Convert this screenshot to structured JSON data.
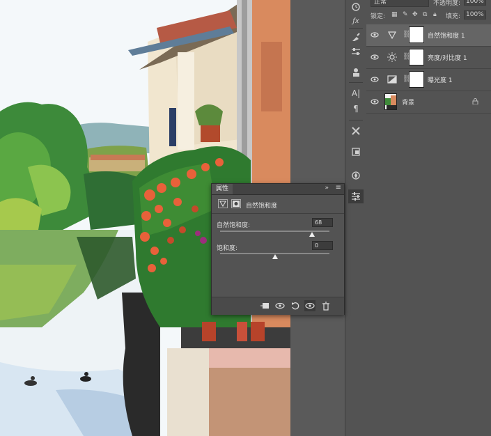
{
  "layers_panel": {
    "blend_mode": "正常",
    "opacity_label": "不透明度:",
    "opacity_value": "100%",
    "lock_label": "锁定:",
    "fill_label": "填充:",
    "fill_value": "100%",
    "layers": [
      {
        "name": "自然饱和度 1",
        "type": "vibrance",
        "selected": true
      },
      {
        "name": "亮度/对比度 1",
        "type": "brightness-contrast",
        "selected": false
      },
      {
        "name": "曝光度 1",
        "type": "exposure",
        "selected": false
      },
      {
        "name": "背景",
        "type": "background",
        "selected": false,
        "locked": true
      }
    ]
  },
  "properties_panel": {
    "tab_label": "属性",
    "adjustment_title": "自然饱和度",
    "vibrance": {
      "label": "自然饱和度:",
      "value": "68",
      "fraction": 0.84
    },
    "saturation": {
      "label": "饱和度:",
      "value": "0",
      "fraction": 0.5
    },
    "footer_icons": [
      "clip-to-layer-icon",
      "view-previous-icon",
      "reset-icon",
      "visibility-icon",
      "delete-icon"
    ]
  },
  "toolbar_icons": [
    "history-icon",
    "fx-icon",
    "brush-preset-icon",
    "adjustments-icon",
    "clone-source-icon",
    "character-icon",
    "paragraph-icon",
    "tools-icon",
    "layer-comps-icon",
    "navigator-icon",
    "properties-icon"
  ]
}
